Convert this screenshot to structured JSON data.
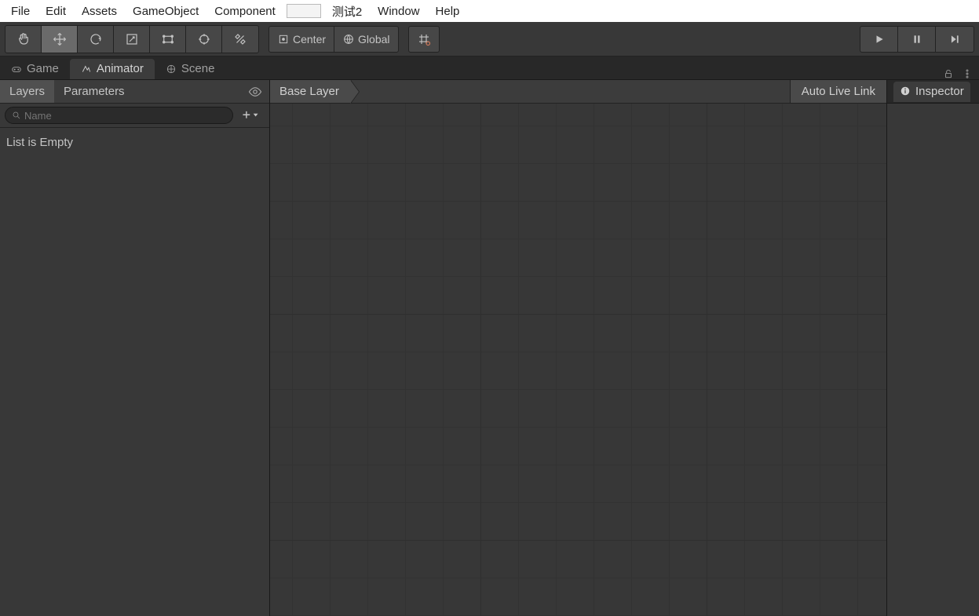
{
  "menubar": {
    "items": [
      "File",
      "Edit",
      "Assets",
      "GameObject",
      "Component"
    ],
    "custom": "测试2",
    "items2": [
      "Window",
      "Help"
    ]
  },
  "toolbar": {
    "pivot": "Center",
    "handle": "Global"
  },
  "tabs": {
    "game": "Game",
    "animator": "Animator",
    "scene": "Scene"
  },
  "left": {
    "layers_label": "Layers",
    "parameters_label": "Parameters",
    "search_placeholder": "Name",
    "empty_text": "List is Empty"
  },
  "center": {
    "breadcrumb": "Base Layer",
    "auto_live_link": "Auto Live Link"
  },
  "inspector": {
    "title": "Inspector"
  }
}
